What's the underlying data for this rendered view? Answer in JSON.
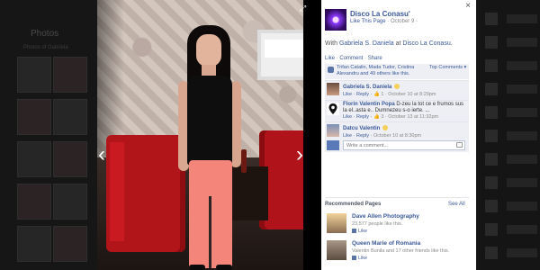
{
  "background": {
    "photos_label": "Photos",
    "photos_sub": "Photos of Gabriela"
  },
  "photo": {
    "prev_icon": "chevron-left-icon",
    "next_icon": "chevron-right-icon",
    "prev_glyph": "‹",
    "next_glyph": "›",
    "expand_glyph": "⤢"
  },
  "panel": {
    "close_glyph": "×",
    "page_name": "Disco La Conasu'",
    "like_page": "Like This Page",
    "date": "October 9",
    "with_prefix": "With",
    "with_person": "Gabriela S. Daniela",
    "at_word": "at",
    "at_place": "Disco La Conasu",
    "actions": [
      "Like",
      "Comment",
      "Share"
    ],
    "likes_text": "Trifan Catalin, Mada Tudor, Cristina Alexandru and 49 others like this.",
    "top_comments": "Top Comments ▾",
    "comments": [
      {
        "name": "Gabriela S. Daniela",
        "text": "",
        "meta_like": "Like · Reply ·",
        "meta_count": "1",
        "meta_time": "· October 10 at 8:29pm"
      },
      {
        "name": "Florin Valentin Popa",
        "text": "D-zeu la tot ce e frumos sus la el..asta e.. Dumnezeu s-o ierte. ...",
        "meta_like": "Like · Reply ·",
        "meta_count": "3",
        "meta_time": "· October 13 at 11:32pm"
      },
      {
        "name": "Datcu Valentin",
        "text": "",
        "meta_like": "Like · Reply ·",
        "meta_count": "",
        "meta_time": "October 10 at 8:30pm"
      }
    ],
    "write_placeholder": "Write a comment...",
    "recommended_title": "Recommended Pages",
    "see_all": "See All",
    "recommended": [
      {
        "name": "Dave Allen Photography",
        "sub": "23,577 people like this.",
        "like": "Like"
      },
      {
        "name": "Queen Marie of Romania",
        "sub": "Valentin Bunila and 17 other friends like this.",
        "like": "Like"
      }
    ]
  },
  "colors": {
    "link": "#3b5998",
    "panel_bg": "#ffffff",
    "comment_bg": "#edeff4",
    "sofa": "#b11419",
    "pants": "#f3857a"
  }
}
